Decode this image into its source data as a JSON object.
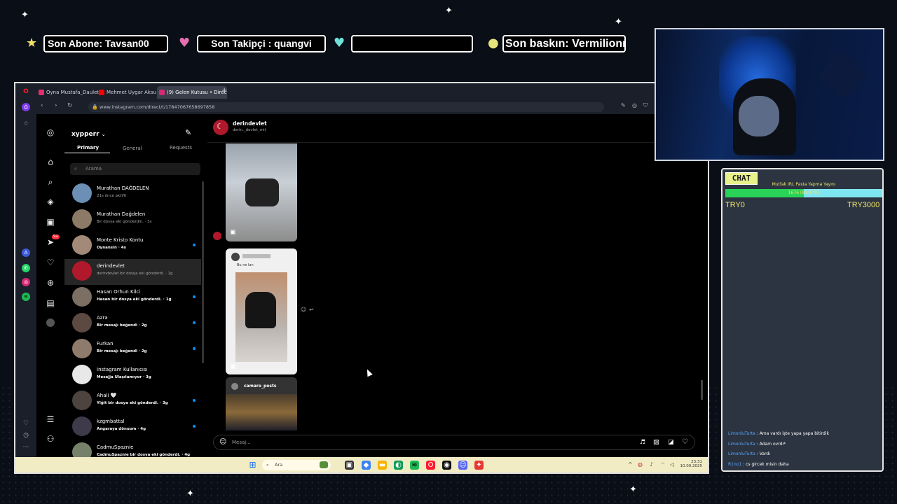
{
  "overlay": {
    "last_sub": "Son Abone: Tavsan00",
    "last_follower": "Son Takipçi : quangvi",
    "third_box": "",
    "last_raid": "Son baskın: Vermilionn"
  },
  "browser": {
    "tabs": [
      {
        "label": "Oyna Mustafa_Daulet_09",
        "color": "#e1306c"
      },
      {
        "label": "Mehmet Uygar Aksu - Aile",
        "color": "#ff0000"
      },
      {
        "label": "(9) Gelen Kutusu • Direct",
        "color": "#d62976"
      }
    ],
    "new_tab": "+",
    "url": "www.instagram.com/direct/t/17847067658697858"
  },
  "instagram": {
    "username": "xypperr",
    "tabs": [
      "Primary",
      "General",
      "Requests"
    ],
    "search_placeholder": "Arama",
    "conversations": [
      {
        "name": "Murathan DAĞDELEN",
        "preview": "21s önce aktifti",
        "bold": false,
        "unread": false,
        "avatar": "#6b8fb5"
      },
      {
        "name": "Murathan Dağdelen",
        "preview": "Bir dosya eki gönderdin. · 3s",
        "bold": false,
        "unread": false,
        "avatar": "#8a7a66"
      },
      {
        "name": "Monte Kristo Kontu",
        "preview": "Oynansin · 4s",
        "bold": true,
        "unread": true,
        "avatar": "#a38a78"
      },
      {
        "name": "derindevlet",
        "preview": "derindevlet bir dosya eki gönderdi. · 1g",
        "bold": false,
        "unread": false,
        "avatar": "#b0192b"
      },
      {
        "name": "Hasan Orhun Kilci",
        "preview": "Hasan bir dosya eki gönderdi. · 1g",
        "bold": true,
        "unread": true,
        "avatar": "#7c6f63"
      },
      {
        "name": "Azra",
        "preview": "Bir mesajı beğendi · 2g",
        "bold": true,
        "unread": true,
        "avatar": "#5c4a42"
      },
      {
        "name": "Furkan",
        "preview": "Bir mesajı beğendi · 2g",
        "bold": true,
        "unread": true,
        "avatar": "#8f7b6c"
      },
      {
        "name": "Instagram Kullanıcısı",
        "preview": "Mesajja Ulaşılamıyor · 3g",
        "bold": true,
        "unread": false,
        "avatar": "#e8e8e8"
      },
      {
        "name": "Ahali 🤍",
        "preview": "Yiğit bir dosya eki gönderdi. · 3g",
        "bold": true,
        "unread": true,
        "avatar": "#4d4440"
      },
      {
        "name": "kzgmbattal",
        "preview": "Angaraya dönuom · 4g",
        "bold": true,
        "unread": true,
        "avatar": "#3e3a4a"
      },
      {
        "name": "CadmuSpaznie",
        "preview": "CadmuSpaznie bir dosya eki gönderdi. · 4g",
        "bold": true,
        "unread": false,
        "avatar": "#76806b"
      }
    ],
    "chat": {
      "name": "derindevlet",
      "handle": "derin._devlet_mit",
      "post2_account": "camaro_posts",
      "post1_caption": "Bu ne lan",
      "composer_placeholder": "Mesaj..."
    }
  },
  "taskbar": {
    "search": "Ara",
    "time": "23:31",
    "date": "10.09.2025"
  },
  "chat_widget": {
    "title": "CHAT",
    "goal_title": "Mutfak IRL Pasta Yapma Yayını",
    "goal_progress_text": "1676 (88.90%)",
    "goal_fraction": 0.5,
    "goal_start": "TRY0",
    "goal_end": "TRY3000",
    "messages": [
      {
        "user": "LimonluTurta",
        "text": "Ama vardı işte yapa yapa bitirdik"
      },
      {
        "user": "LimonluTurta",
        "text": "Adam ovrdı*"
      },
      {
        "user": "LimonluTurta",
        "text": "Vardı"
      },
      {
        "user": "R1no1",
        "text": "cs gircek misin daha"
      }
    ]
  }
}
